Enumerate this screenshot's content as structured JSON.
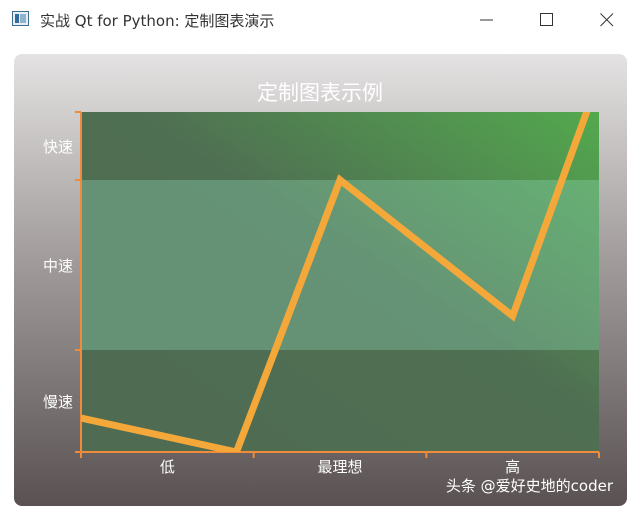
{
  "window": {
    "title": "实战 Qt for Python: 定制图表演示",
    "icon": "app-icon",
    "controls": [
      "minimize-icon",
      "maximize-icon",
      "close-icon"
    ]
  },
  "watermark": "头条 @爱好史地的coder",
  "colors": {
    "line": "#f5a83a",
    "axis": "#ef8b3a",
    "plot_gradient": [
      "#4f6b52",
      "#53a94e"
    ],
    "band": "#8fd8b8",
    "text": "#ffffff",
    "panel_gradient": [
      "#e4e2e2",
      "#5a5252"
    ]
  },
  "chart_data": {
    "type": "line",
    "title": "定制图表示例",
    "xlabel": "",
    "ylabel": "",
    "x_categories": [
      "低",
      "最理想",
      "高"
    ],
    "y_categories": [
      "慢速",
      "中速",
      "快速"
    ],
    "xlim": [
      0,
      6
    ],
    "ylim": [
      0,
      20
    ],
    "grid": false,
    "legend": "none",
    "bands": [
      {
        "y_from": 6,
        "y_to": 16
      }
    ],
    "series": [
      {
        "x": [
          0,
          1.8,
          3,
          5,
          6
        ],
        "y": [
          2,
          0,
          16,
          8,
          22
        ]
      }
    ]
  }
}
